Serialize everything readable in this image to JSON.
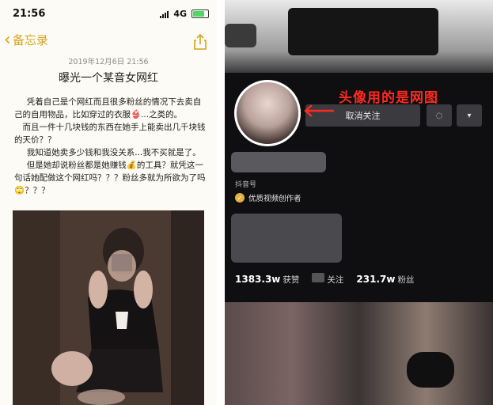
{
  "notes": {
    "status_time": "21:56",
    "network": "4G",
    "back_label": "备忘录",
    "date": "2019年12月6日 21:56",
    "title": "曝光一个某音女网红",
    "paragraphs": [
      "凭着自己是个网红而且很多粉丝的情况下去卖自己的自用物品，比如穿过的衣服👙...之类的。",
      "而且一件十几块钱的东西在她手上能卖出几千块钱的天价？？",
      "我知道她卖多少钱和我没关系...我不买就是了。",
      "但是她却说粉丝都是她赚钱💰的工具？就凭这一句话她配做这个网红吗？？？粉丝多就为所欲为了吗🙄？？？"
    ]
  },
  "profile": {
    "annotation": "头像用的是网图",
    "unfollow_label": "取消关注",
    "douyin_id_label": "抖音号",
    "creator_badge": "优质视频创作者",
    "likes_value": "1383.3w",
    "likes_label": "获赞",
    "following_label": "关注",
    "followers_value": "231.7w",
    "followers_label": "粉丝"
  }
}
